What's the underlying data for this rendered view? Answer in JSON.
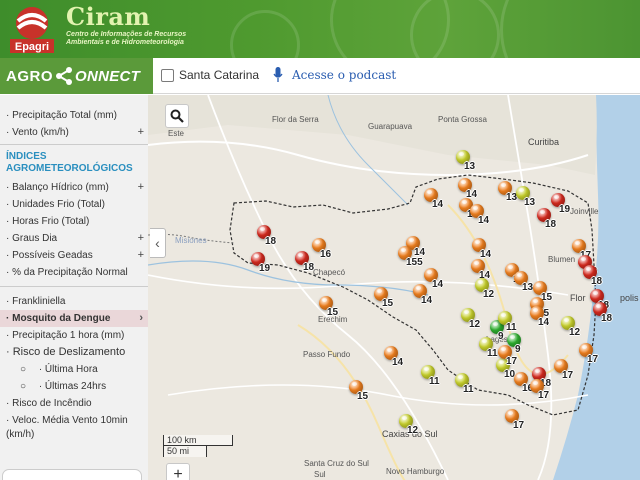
{
  "header": {
    "logo_text": "Epagri",
    "org_name": "Ciram",
    "org_sub_line1": "Centro de Informações de Recursos",
    "org_sub_line2": "Ambientais e de Hidrometeorologia"
  },
  "navbar": {
    "brand_agro": "AGRO",
    "brand_connect": "ONNECT",
    "state_filter_label": "Santa Catarina",
    "state_filter_checked": false,
    "podcast_link": "Acesse o podcast"
  },
  "sidebar": {
    "top_items": [
      {
        "label": "· Precipitação Total (mm)",
        "expand": ""
      },
      {
        "label": "· Vento (km/h)",
        "expand": "+"
      }
    ],
    "section_heading_line1": "ÍNDICES",
    "section_heading_line2": "AGROMETEOROLÓGICOS",
    "index_items": [
      {
        "label": "· Balanço Hídrico (mm)",
        "expand": "+"
      },
      {
        "label": "· Unidades Frio (Total)",
        "expand": ""
      },
      {
        "label": "· Horas Frio (Total)",
        "expand": ""
      },
      {
        "label": "· Graus Dia",
        "expand": "+"
      },
      {
        "label": "· Possíveis Geadas",
        "expand": "+"
      },
      {
        "label": "· % da Precipitação Normal",
        "expand": ""
      }
    ],
    "other_items": [
      {
        "label": "· Frankliniella"
      },
      {
        "label": "· Mosquito da Dengue",
        "active": true,
        "arrow": "›"
      },
      {
        "label": "· Precipitação 1 hora (mm)"
      },
      {
        "label": "· Risco de Deslizamento"
      }
    ],
    "sub_items": [
      {
        "bullet": "○",
        "label": "· Última Hora"
      },
      {
        "bullet": "○",
        "label": "· Últimas 24hrs"
      }
    ],
    "last_items": [
      {
        "label": "· Risco de Incêndio"
      },
      {
        "label_line1": "· Veloc. Média Vento 10min",
        "label_line2": "(km/h)"
      }
    ]
  },
  "map": {
    "collapse_icon": "‹",
    "search_icon": "search-icon",
    "scale_km": "100 km",
    "scale_mi": "50 mi",
    "zoom_in": "+",
    "places": [
      "Este",
      "Flor da Serra",
      "Guarapuava",
      "Ponta Grossa",
      "Curitiba",
      "Joinville",
      "Blumen",
      "Flor",
      "polis",
      "Misiones",
      "Chapecó",
      "Erechim",
      "Lages",
      "Passo Fundo",
      "Caxias do Sul",
      "Santa Cruz do Sul",
      "Novo Hamburgo",
      "Sul"
    ],
    "color_legend": {
      "red": "#d42a1f",
      "orange": "#ee7f1f",
      "yellow_green": "#c6cf2c",
      "green": "#2eae2f"
    },
    "markers": [
      {
        "value": "13",
        "color": "yellow_green"
      },
      {
        "value": "14",
        "color": "orange"
      },
      {
        "value": "14",
        "color": "orange"
      },
      {
        "value": "13",
        "color": "orange"
      },
      {
        "value": "14",
        "color": "orange"
      },
      {
        "value": "14",
        "color": "orange"
      },
      {
        "value": "13",
        "color": "yellow_green"
      },
      {
        "value": "19",
        "color": "red"
      },
      {
        "value": "18",
        "color": "red"
      },
      {
        "value": "18",
        "color": "red"
      },
      {
        "value": "16",
        "color": "orange"
      },
      {
        "value": "19",
        "color": "red"
      },
      {
        "value": "18",
        "color": "red"
      },
      {
        "value": "14",
        "color": "orange"
      },
      {
        "value": "155",
        "color": "orange"
      },
      {
        "value": "14",
        "color": "orange"
      },
      {
        "value": "14",
        "color": "orange"
      },
      {
        "value": "15",
        "color": "orange"
      },
      {
        "value": "15",
        "color": "orange"
      },
      {
        "value": "14",
        "color": "orange"
      },
      {
        "value": "14",
        "color": "orange"
      },
      {
        "value": "12",
        "color": "yellow_green"
      },
      {
        "value": "14",
        "color": "orange"
      },
      {
        "value": "13",
        "color": "orange"
      },
      {
        "value": "15",
        "color": "orange"
      },
      {
        "value": "17",
        "color": "orange"
      },
      {
        "value": "18",
        "color": "red"
      },
      {
        "value": "18",
        "color": "red"
      },
      {
        "value": "15",
        "color": "orange"
      },
      {
        "value": "14",
        "color": "orange"
      },
      {
        "value": "12",
        "color": "yellow_green"
      },
      {
        "value": "9",
        "color": "green"
      },
      {
        "value": "11",
        "color": "yellow_green"
      },
      {
        "value": "9",
        "color": "green"
      },
      {
        "value": "11",
        "color": "yellow_green"
      },
      {
        "value": "12",
        "color": "yellow_green"
      },
      {
        "value": "18",
        "color": "red"
      },
      {
        "value": "18",
        "color": "red"
      },
      {
        "value": "17",
        "color": "orange"
      },
      {
        "value": "14",
        "color": "orange"
      },
      {
        "value": "15",
        "color": "orange"
      },
      {
        "value": "11",
        "color": "yellow_green"
      },
      {
        "value": "11",
        "color": "yellow_green"
      },
      {
        "value": "10",
        "color": "yellow_green"
      },
      {
        "value": "16",
        "color": "orange"
      },
      {
        "value": "18",
        "color": "red"
      },
      {
        "value": "17",
        "color": "orange"
      },
      {
        "value": "17",
        "color": "orange"
      },
      {
        "value": "17",
        "color": "orange"
      },
      {
        "value": "12",
        "color": "yellow_green"
      },
      {
        "value": "17",
        "color": "orange"
      }
    ]
  }
}
